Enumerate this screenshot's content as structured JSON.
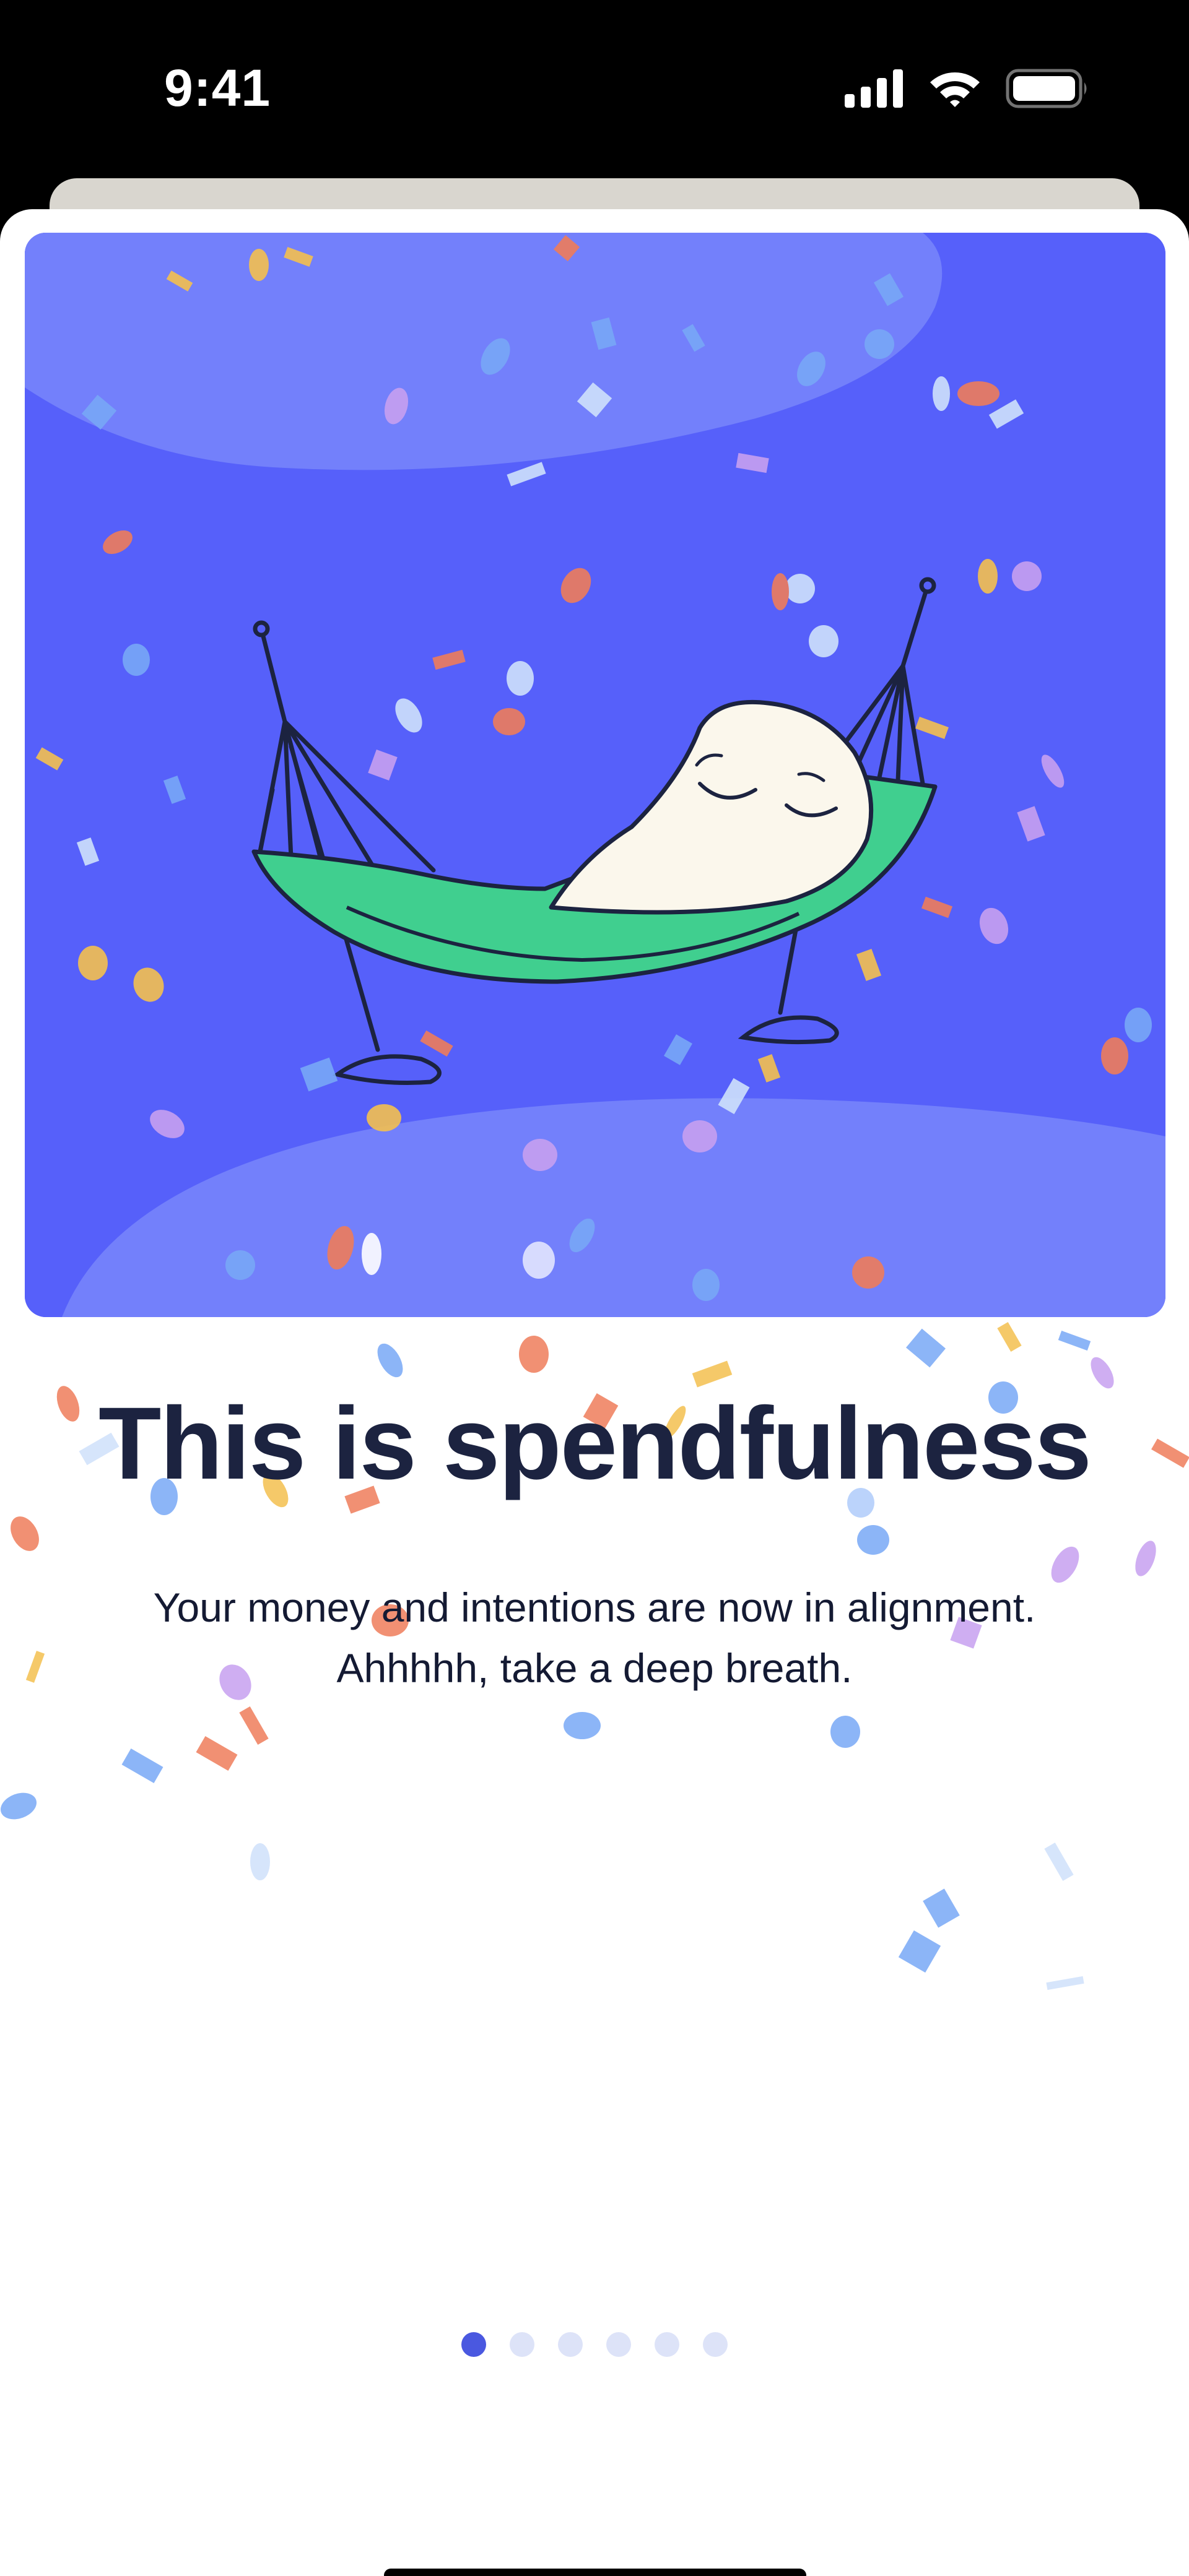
{
  "status_bar": {
    "time": "9:41",
    "icons": [
      "cellular-signal-icon",
      "wifi-icon",
      "battery-icon"
    ]
  },
  "onboarding": {
    "title": "This is spendfulness",
    "subtitle_line1": "Your money and intentions are now in alignment.",
    "subtitle_line2": "Ahhhhh, take a deep breath.",
    "illustration": "character-in-hammock-illustration"
  },
  "pager": {
    "total_pages": 6,
    "current_page": 1
  },
  "colors": {
    "hero_background": "#5660fa",
    "hero_cloud": "#7380fb",
    "hammock_green": "#40cf8f",
    "ink": "#1c2340",
    "dot_active": "#4a58e0",
    "dot_inactive": "#dde3f8",
    "back_sheet": "#d9d6cf"
  }
}
